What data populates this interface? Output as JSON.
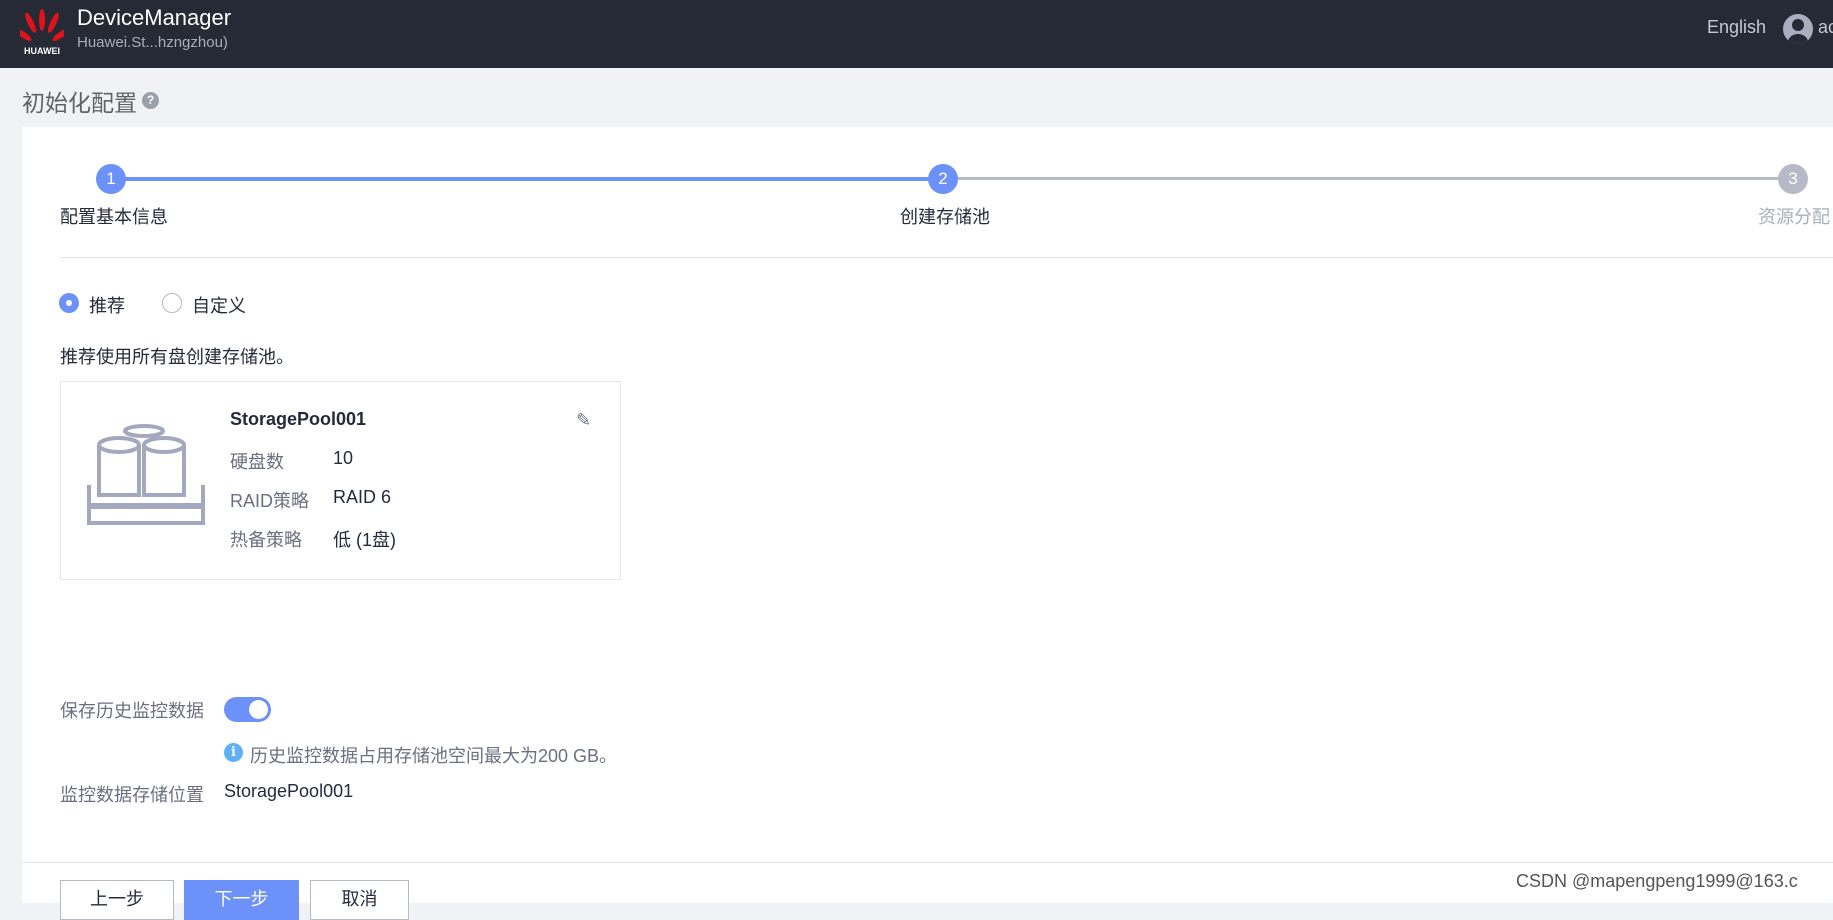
{
  "header": {
    "logo_text": "HUAWEI",
    "app_title": "DeviceManager",
    "subtitle": "Huawei.St...hzngzhou)",
    "language": "English",
    "user": "ac"
  },
  "page": {
    "title": "初始化配置",
    "help": "?"
  },
  "steps": [
    {
      "num": "1",
      "label": "配置基本信息",
      "state": "done"
    },
    {
      "num": "2",
      "label": "创建存储池",
      "state": "active"
    },
    {
      "num": "3",
      "label": "资源分配",
      "state": "pending"
    }
  ],
  "mode": {
    "options": [
      "推荐",
      "自定义"
    ],
    "selected": "推荐"
  },
  "hint": "推荐使用所有盘创建存储池。",
  "pool": {
    "name": "StoragePool001",
    "rows": [
      {
        "label": "硬盘数",
        "value": "10"
      },
      {
        "label": "RAID策略",
        "value": "RAID 6"
      },
      {
        "label": "热备策略",
        "value": "低 (1盘)"
      }
    ]
  },
  "monitor": {
    "label": "保存历史监控数据",
    "enabled": true,
    "info_icon": "i",
    "info": "历史监控数据占用存储池空间最大为200 GB。",
    "location_label": "监控数据存储位置",
    "location_value": "StoragePool001"
  },
  "footer": {
    "prev": "上一步",
    "next": "下一步",
    "cancel": "取消"
  },
  "watermark": "CSDN @mapengpeng1999@163.c",
  "colors": {
    "accent": "#6c92fa",
    "header_bg": "#252a35",
    "pending": "#b6bac6"
  }
}
